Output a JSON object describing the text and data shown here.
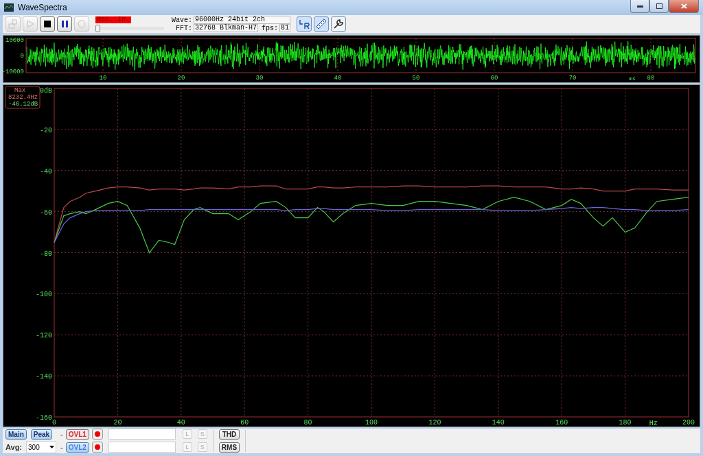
{
  "window": {
    "title": "WaveSpectra"
  },
  "toolbar": {
    "transport": [
      {
        "kind": "export",
        "disabled": true
      },
      {
        "kind": "play",
        "disabled": true
      },
      {
        "kind": "stop",
        "disabled": false
      },
      {
        "kind": "pause",
        "disabled": false
      },
      {
        "kind": "record",
        "disabled": true
      }
    ],
    "rec_input": {
      "label": "Rec. In.",
      "level": 0
    },
    "wave": {
      "label": "Wave:",
      "value": "96000Hz 24bit 2ch"
    },
    "fft": {
      "label": "FFT:",
      "value": "32768 Blkman-H7"
    },
    "fps": {
      "label": "fps:",
      "value": "81"
    },
    "tools": [
      {
        "kind": "channels"
      },
      {
        "kind": "scale"
      },
      {
        "kind": "settings"
      }
    ]
  },
  "waveform": {
    "y_labels": [
      "10000",
      "0",
      "-10000"
    ],
    "x_labels": [
      "10",
      "20",
      "30",
      "40",
      "50",
      "60",
      "70",
      "80"
    ],
    "unit": "ms"
  },
  "spectrum": {
    "marker": {
      "label": "Max",
      "frequency": "8232.4Hz",
      "level": "-46.12dB"
    },
    "chart_data": {
      "type": "line",
      "xlabel": "Hz",
      "grid": true,
      "xlim": [
        0,
        200
      ],
      "ylim": [
        -160,
        0
      ],
      "xticks": [
        0,
        20,
        40,
        60,
        80,
        100,
        120,
        140,
        160,
        180,
        200
      ],
      "yticks": [
        {
          "value": 0,
          "label": "0dB"
        },
        -20,
        -40,
        -60,
        -80,
        -100,
        -120,
        -140,
        -160
      ],
      "x": [
        0,
        3,
        5,
        8,
        10,
        13,
        17,
        20,
        23,
        27,
        30,
        33,
        36,
        38,
        41,
        44,
        46,
        50,
        55,
        58,
        62,
        65,
        70,
        73,
        76,
        80,
        83,
        85,
        88,
        91,
        95,
        100,
        105,
        110,
        115,
        120,
        125,
        130,
        135,
        140,
        145,
        150,
        155,
        160,
        163,
        166,
        170,
        173,
        176,
        180,
        183,
        187,
        190,
        195,
        200
      ],
      "series": [
        {
          "color": "#c04848",
          "values": [
            -75,
            -58,
            -55,
            -53,
            -51,
            -50,
            -48.5,
            -48,
            -48,
            -48.5,
            -49.5,
            -49,
            -49,
            -49,
            -49.5,
            -49,
            -48.5,
            -48.5,
            -49,
            -48,
            -48,
            -47.5,
            -47.5,
            -49,
            -49,
            -49,
            -48,
            -48,
            -48.5,
            -48.5,
            -48,
            -48,
            -48,
            -47.5,
            -47.5,
            -48,
            -48,
            -48,
            -47.5,
            -47.5,
            -48,
            -48,
            -48,
            -49,
            -49,
            -48.5,
            -49,
            -50,
            -50,
            -50,
            -49,
            -49,
            -49,
            -49.5,
            -49.5
          ]
        },
        {
          "color": "#48c848",
          "values": [
            -75,
            -62,
            -61,
            -60,
            -61,
            -59,
            -56,
            -55,
            -57,
            -68,
            -80,
            -74,
            -75,
            -76,
            -64,
            -59,
            -58,
            -61,
            -61,
            -64,
            -60,
            -56,
            -55,
            -58,
            -63,
            -63,
            -58,
            -60,
            -65,
            -61,
            -57,
            -56,
            -57,
            -57,
            -55,
            -55,
            -56,
            -57,
            -59,
            -55,
            -53,
            -55,
            -59,
            -57,
            -54,
            -56,
            -63,
            -67,
            -63,
            -70,
            -68,
            -60,
            -55,
            -54,
            -53
          ]
        },
        {
          "color": "#6868e0",
          "values": [
            -75,
            -66,
            -63,
            -61,
            -60,
            -59.5,
            -59.5,
            -59.5,
            -59.5,
            -59.5,
            -59,
            -59,
            -59,
            -59,
            -59,
            -59,
            -59,
            -59,
            -59,
            -59,
            -59,
            -59,
            -59,
            -59.5,
            -59,
            -59,
            -58.5,
            -58.5,
            -59,
            -59,
            -59,
            -59,
            -59.5,
            -59.5,
            -59,
            -59,
            -59,
            -59,
            -59,
            -59.5,
            -59.5,
            -59.5,
            -59,
            -58.5,
            -58,
            -58.5,
            -58,
            -58,
            -58.5,
            -59,
            -59,
            -59.5,
            -59.5,
            -59.5,
            -59
          ]
        }
      ]
    }
  },
  "bottom": {
    "views": [
      {
        "label": "Main",
        "on": true
      },
      {
        "label": "Peak",
        "on": true
      }
    ],
    "avg": {
      "label": "Avg:",
      "value": "300"
    },
    "overlays": [
      {
        "dash": "-",
        "label": "OVL1",
        "color": "#d03030",
        "on": false,
        "load": "L",
        "save": "S",
        "disabled": true
      },
      {
        "dash": "-",
        "label": "OVL2",
        "color": "#4a7ee0",
        "on": true,
        "load": "L",
        "save": "S",
        "disabled": true
      }
    ],
    "analysis": [
      {
        "label": "THD"
      },
      {
        "label": "RMS"
      }
    ]
  }
}
